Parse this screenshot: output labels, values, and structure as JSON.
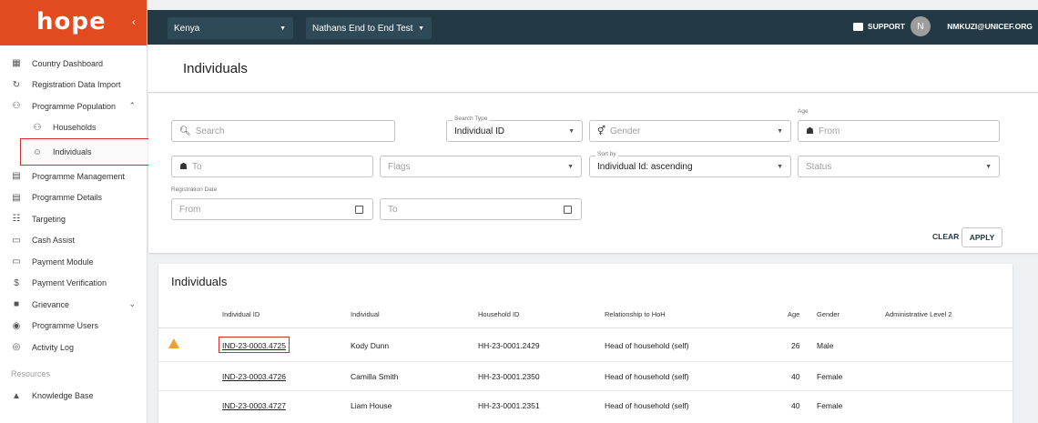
{
  "brand": {
    "logo_text": "hope"
  },
  "sidebar": {
    "items": [
      {
        "label": "Country Dashboard",
        "icon": "dashboard-icon"
      },
      {
        "label": "Registration Data Import",
        "icon": "sync-icon"
      },
      {
        "label": "Programme Population",
        "icon": "people-icon"
      },
      {
        "label": "Households",
        "icon": "households-icon"
      },
      {
        "label": "Individuals",
        "icon": "face-icon"
      },
      {
        "label": "Programme Management",
        "icon": "clipboard-icon"
      },
      {
        "label": "Programme Details",
        "icon": "clipboard-icon"
      },
      {
        "label": "Targeting",
        "icon": "list-icon"
      },
      {
        "label": "Cash Assist",
        "icon": "card-icon"
      },
      {
        "label": "Payment Module",
        "icon": "card-icon"
      },
      {
        "label": "Payment Verification",
        "icon": "dollar-icon"
      },
      {
        "label": "Grievance",
        "icon": "feedback-icon"
      },
      {
        "label": "Programme Users",
        "icon": "users-icon"
      },
      {
        "label": "Activity Log",
        "icon": "fingerprint-icon"
      }
    ],
    "resources_label": "Resources",
    "knowledge_base": "Knowledge Base"
  },
  "topbar": {
    "country": "Kenya",
    "programme": "Nathans End to End Test",
    "support": "SUPPORT",
    "avatar_initial": "N",
    "user_email": "NMKUZI@UNICEF.ORG"
  },
  "page": {
    "title": "Individuals"
  },
  "filters": {
    "search_placeholder": "Search",
    "search_type_label": "Search Type",
    "search_type_value": "Individual ID",
    "gender_placeholder": "Gender",
    "age_label": "Age",
    "age_from": "From",
    "age_to": "To",
    "flags_placeholder": "Flags",
    "sort_by_label": "Sort by",
    "sort_by_value": "Individual Id: ascending",
    "status_placeholder": "Status",
    "registration_date_label": "Registration Date",
    "date_from": "From",
    "date_to": "To",
    "clear": "CLEAR",
    "apply": "APPLY"
  },
  "table": {
    "title": "Individuals",
    "columns": [
      "Individual ID",
      "Individual",
      "Household ID",
      "Relationship to HoH",
      "Age",
      "Gender",
      "Administrative Level 2"
    ],
    "rows": [
      {
        "id": "IND-23-0003.4725",
        "name": "Kody Dunn",
        "household": "HH-23-0001.2429",
        "relationship": "Head of household (self)",
        "age": "26",
        "gender": "Male",
        "admin2": ""
      },
      {
        "id": "IND-23-0003.4726",
        "name": "Camilla Smith",
        "household": "HH-23-0001.2350",
        "relationship": "Head of household (self)",
        "age": "40",
        "gender": "Female",
        "admin2": ""
      },
      {
        "id": "IND-23-0003.4727",
        "name": "Liam House",
        "household": "HH-23-0001.2351",
        "relationship": "Head of household (self)",
        "age": "40",
        "gender": "Female",
        "admin2": ""
      }
    ]
  },
  "colors": {
    "brand": "#e24a1f",
    "topbar": "#233944",
    "highlight": "#d32f2f",
    "warning": "#f0a030"
  }
}
